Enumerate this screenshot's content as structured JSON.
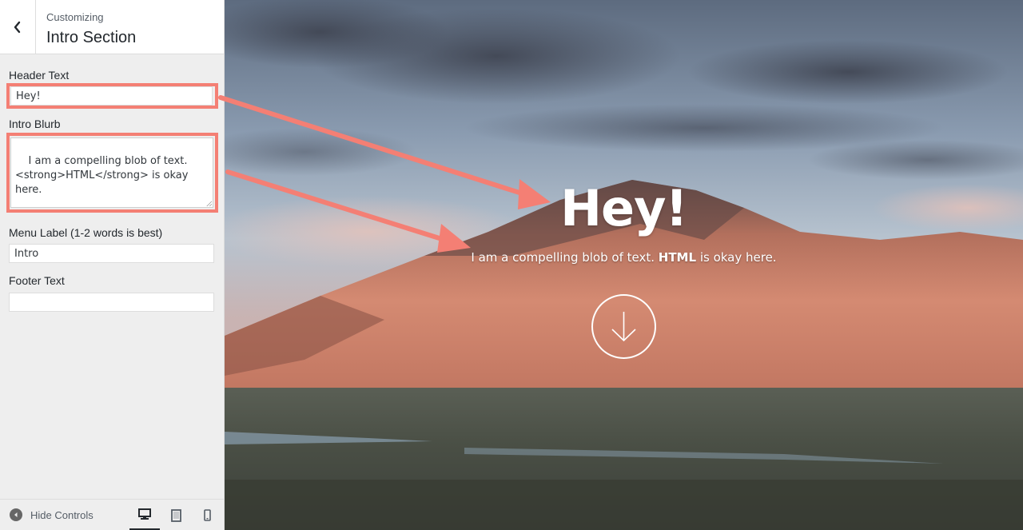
{
  "sidebar": {
    "eyebrow": "Customizing",
    "title": "Intro Section",
    "back_icon": "chevron-left-icon",
    "fields": {
      "header_text": {
        "label": "Header Text",
        "value": "Hey!"
      },
      "intro_blurb": {
        "label": "Intro Blurb",
        "value": "I am a compelling blob of text.\n<strong>HTML</strong> is okay\nhere."
      },
      "menu_label": {
        "label": "Menu Label (1-2 words is best)",
        "value": "Intro"
      },
      "footer_text": {
        "label": "Footer Text",
        "value": ""
      }
    },
    "footer": {
      "hide_controls": "Hide Controls",
      "devices": [
        "desktop-icon",
        "tablet-icon",
        "mobile-icon"
      ],
      "active_device": "desktop"
    }
  },
  "preview": {
    "hero_title": "Hey!",
    "hero_blurb_prefix": "I am a compelling blob of text. ",
    "hero_blurb_strong": "HTML",
    "hero_blurb_suffix": " is okay here.",
    "scroll_icon": "arrow-down-icon"
  },
  "colors": {
    "highlight": "#f47f74",
    "sidebar_bg": "#eeeeee"
  }
}
